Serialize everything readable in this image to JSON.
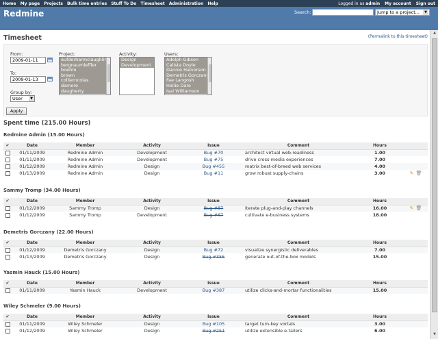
{
  "top_menu": {
    "items": [
      "Home",
      "My page",
      "Projects",
      "Bulk time entries",
      "Stuff To Do",
      "Timesheet",
      "Administration",
      "Help"
    ],
    "logged_in_prefix": "Logged in as",
    "user": "admin",
    "my_account": "My account",
    "sign_out": "Sign out"
  },
  "header": {
    "app_title": "Redmine",
    "search_label": "Search:",
    "search_value": "",
    "jump_label": "Jump to a project..."
  },
  "page": {
    "title": "Timesheet",
    "permalink": "(Permalink to this timesheet)"
  },
  "filters": {
    "from_label": "From:",
    "from_value": "2009-01-11",
    "to_label": "To:",
    "to_value": "2009-01-13",
    "project_label": "Project:",
    "projects": [
      "aufderharmclaughlin",
      "bergnaumleffler",
      "boehm",
      "brown",
      "collierncolas",
      "damore",
      "daugherty"
    ],
    "activity_label": "Activity:",
    "activities": [
      "Design",
      "Development"
    ],
    "users_label": "Users:",
    "users": [
      "Adolph Gibson",
      "Calista Doyle",
      "Dannie Halvorson",
      "Demetris Gorczany",
      "Fae Langosh",
      "Hallie Dare",
      "Isai Williamson"
    ],
    "group_by_label": "Group by:",
    "group_by_value": "User",
    "apply_label": "Apply"
  },
  "spent_time": "Spent time (215.00 Hours)",
  "columns": {
    "check": "✔",
    "date": "Date",
    "member": "Member",
    "activity": "Activity",
    "issue": "Issue",
    "comment": "Comment",
    "hours": "Hours"
  },
  "groups": [
    {
      "title": "Redmine Admin (15.00 Hours)",
      "rows": [
        {
          "date": "01/11/2009",
          "member": "Redmine Admin",
          "activity": "Development",
          "issue": "Bug #70",
          "comment": "architect virtual web-readiness",
          "hours": "1.00"
        },
        {
          "date": "01/11/2009",
          "member": "Redmine Admin",
          "activity": "Development",
          "issue": "Bug #75",
          "comment": "drive cross-media experiences",
          "hours": "7.00"
        },
        {
          "date": "01/12/2009",
          "member": "Redmine Admin",
          "activity": "Design",
          "issue": "Bug #455",
          "comment": "matrix best-of-breed web services",
          "hours": "4.00"
        },
        {
          "date": "01/13/2009",
          "member": "Redmine Admin",
          "activity": "Design",
          "issue": "Bug #11",
          "comment": "grow robust supply-chains",
          "hours": "3.00"
        }
      ]
    },
    {
      "title": "Sammy Tromp (34.00 Hours)",
      "rows": [
        {
          "date": "01/12/2009",
          "member": "Sammy Tromp",
          "activity": "Design",
          "issue": "Bug #87",
          "comment": "iterate plug-and-play channels",
          "hours": "16.00"
        },
        {
          "date": "01/12/2009",
          "member": "Sammy Tromp",
          "activity": "Development",
          "issue": "Bug #67",
          "comment": "cultivate e-business systems",
          "hours": "18.00"
        }
      ]
    },
    {
      "title": "Demetris Gorczany (22.00 Hours)",
      "rows": [
        {
          "date": "01/12/2009",
          "member": "Demetris Gorczany",
          "activity": "Design",
          "issue": "Bug #72",
          "comment": "visualize synergistic deliverables",
          "hours": "7.00"
        },
        {
          "date": "01/13/2009",
          "member": "Demetris Gorczany",
          "activity": "Design",
          "issue": "Bug #356",
          "comment": "generate out-of-the-box models",
          "hours": "15.00"
        }
      ]
    },
    {
      "title": "Yasmin Hauck (15.00 Hours)",
      "rows": [
        {
          "date": "01/11/2009",
          "member": "Yasmin Hauck",
          "activity": "Development",
          "issue": "Bug #387",
          "comment": "utilize clicks-and-mortar functionalities",
          "hours": "15.00"
        }
      ]
    },
    {
      "title": "Wiley Schmeler (9.00 Hours)",
      "rows": [
        {
          "date": "01/11/2009",
          "member": "Wiley Schmeler",
          "activity": "Design",
          "issue": "Bug #105",
          "comment": "target turn-key vortals",
          "hours": "3.00"
        },
        {
          "date": "01/12/2009",
          "member": "Wiley Schmeler",
          "activity": "Design",
          "issue": "Bug #251",
          "comment": "utilize extensible e-tailers",
          "hours": "6.00"
        }
      ]
    }
  ],
  "icons": {
    "edit": "pencil-icon",
    "delete": "trash-icon",
    "calendar": "calendar-icon"
  },
  "colors": {
    "top_menu_bg": "#2C4056",
    "header_bg": "#507AAA",
    "link": "#2A5685",
    "check": "#3A9A2A"
  }
}
